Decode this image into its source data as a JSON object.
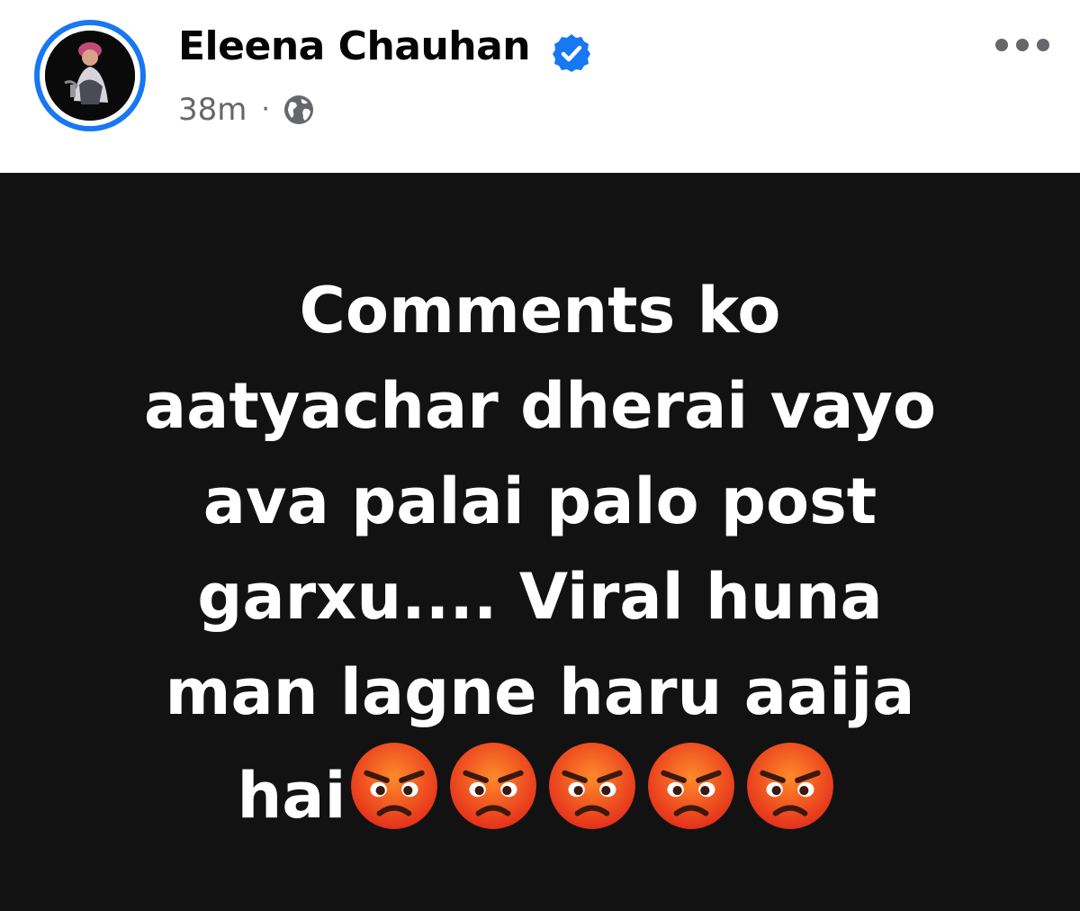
{
  "post": {
    "author_name": "Eleena Chauhan",
    "verified": true,
    "timestamp": "38m",
    "separator": "·",
    "audience_icon": "globe-icon",
    "more_icon": "more-options-icon",
    "text_lines": [
      "Comments ko",
      "aatyachar dherai vayo",
      "ava palai palo post",
      "garxu.... Viral huna",
      "man lagne haru aaija",
      "hai"
    ],
    "emojis": [
      "angry-face-icon",
      "angry-face-icon",
      "angry-face-icon",
      "angry-face-icon",
      "angry-face-icon"
    ],
    "background_color": "#121212",
    "text_color": "#ffffff"
  },
  "colors": {
    "accent": "#1877f2",
    "meta_text": "#65676b",
    "name_text": "#050505"
  }
}
